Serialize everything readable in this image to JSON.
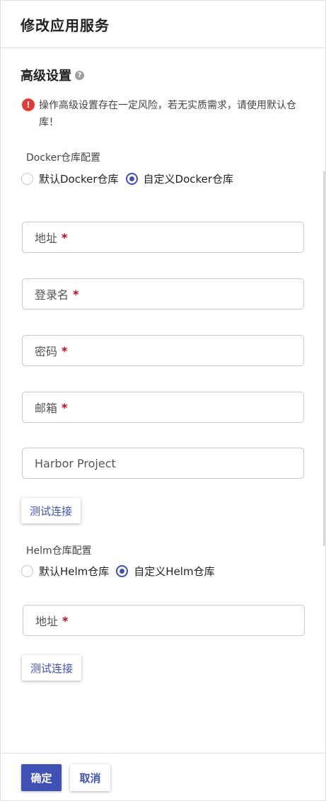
{
  "header": {
    "title": "修改应用服务"
  },
  "advanced": {
    "title": "高级设置",
    "help_icon": "question-circle-icon",
    "help_glyph": "?",
    "warning_icon": "exclamation-circle-icon",
    "warning_glyph": "!",
    "warning": "操作高级设置存在一定风险，若无实质需求，请使用默认仓库！"
  },
  "docker": {
    "group_label": "Docker仓库配置",
    "options": [
      {
        "label": "默认Docker仓库",
        "checked": false
      },
      {
        "label": "自定义Docker仓库",
        "checked": true
      }
    ],
    "fields": [
      {
        "placeholder": "地址",
        "required": true
      },
      {
        "placeholder": "登录名",
        "required": true
      },
      {
        "placeholder": "密码",
        "required": true
      },
      {
        "placeholder": "邮箱",
        "required": true
      },
      {
        "placeholder": "Harbor Project",
        "required": false
      }
    ],
    "test_button": "测试连接"
  },
  "helm": {
    "group_label": "Helm仓库配置",
    "options": [
      {
        "label": "默认Helm仓库",
        "checked": false
      },
      {
        "label": "自定义Helm仓库",
        "checked": true
      }
    ],
    "fields": [
      {
        "placeholder": "地址",
        "required": true
      }
    ],
    "test_button": "测试连接"
  },
  "required_mark": "*",
  "colors": {
    "primary": "#3f51b5",
    "danger": "#e53935",
    "required": "#d0021b"
  },
  "footer": {
    "ok_label": "确定",
    "cancel_label": "取消"
  }
}
